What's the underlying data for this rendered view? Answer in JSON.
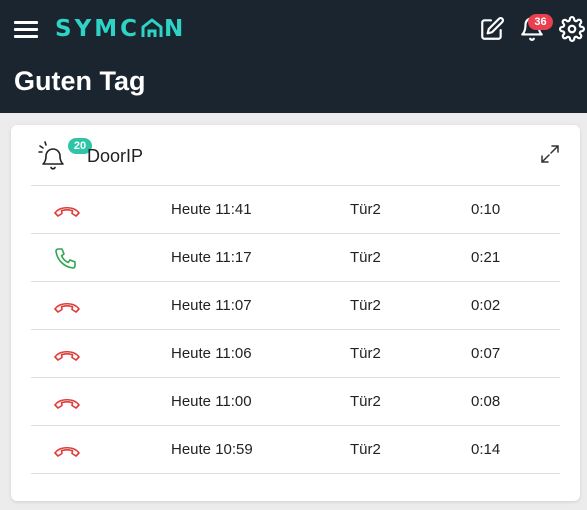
{
  "header": {
    "brand": "SYMC⌂N",
    "brand_parts": [
      "SYMC",
      "N"
    ],
    "notification_count": "36",
    "title": "Guten Tag"
  },
  "colors": {
    "topbar": "#1b2530",
    "brand": "#2ed3c5",
    "badge_red": "#e8404f",
    "badge_green": "#2ec4a6",
    "missed_call": "#e03a3a",
    "answered_call": "#2fa84f"
  },
  "card": {
    "title": "DoorIP",
    "badge": "20",
    "rows": [
      {
        "icon": "missed-call-icon",
        "time": "Heute 11:41",
        "door": "Tür2",
        "duration": "0:10"
      },
      {
        "icon": "answered-call-icon",
        "time": "Heute 11:17",
        "door": "Tür2",
        "duration": "0:21"
      },
      {
        "icon": "missed-call-icon",
        "time": "Heute 11:07",
        "door": "Tür2",
        "duration": "0:02"
      },
      {
        "icon": "missed-call-icon",
        "time": "Heute 11:06",
        "door": "Tür2",
        "duration": "0:07"
      },
      {
        "icon": "missed-call-icon",
        "time": "Heute 11:00",
        "door": "Tür2",
        "duration": "0:08"
      },
      {
        "icon": "missed-call-icon",
        "time": "Heute 10:59",
        "door": "Tür2",
        "duration": "0:14"
      }
    ]
  }
}
